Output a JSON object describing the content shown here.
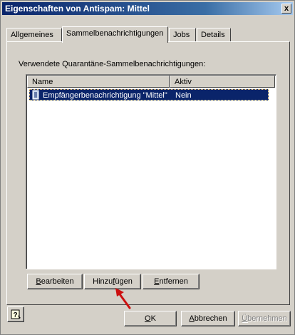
{
  "window": {
    "title": "Eigenschaften von Antispam: Mittel",
    "close_symbol": "x"
  },
  "tabs": [
    {
      "label": "Allgemeines",
      "active": false
    },
    {
      "label": "Sammelbenachrichtigungen",
      "active": true
    },
    {
      "label": "Jobs",
      "active": false
    },
    {
      "label": "Details",
      "active": false
    }
  ],
  "panel": {
    "section_label": "Verwendete Quarantäne-Sammelbenachrichtigungen:",
    "list": {
      "columns": [
        "Name",
        "Aktiv"
      ],
      "rows": [
        {
          "name": "Empfängerbenachrichtigung \"Mittel\"",
          "active": "Nein",
          "selected": true,
          "icon": "document-icon"
        }
      ]
    },
    "buttons": {
      "edit": {
        "pre": "",
        "key": "B",
        "post": "earbeiten"
      },
      "add": {
        "pre": "Hinzu",
        "key": "f",
        "post": "ügen"
      },
      "remove": {
        "pre": "",
        "key": "E",
        "post": "ntfernen"
      }
    }
  },
  "footer": {
    "help_icon": "help-question-icon",
    "ok": {
      "pre": "",
      "key": "O",
      "post": "K"
    },
    "cancel": {
      "pre": "",
      "key": "A",
      "post": "bbrechen"
    },
    "apply": {
      "pre": "",
      "key": "Ü",
      "post": "bernehmen",
      "disabled": true
    }
  },
  "colors": {
    "titlebar": "#0a246a",
    "selection": "#0a246a",
    "face": "#d4d0c8",
    "annotation_arrow": "#cc1010"
  }
}
